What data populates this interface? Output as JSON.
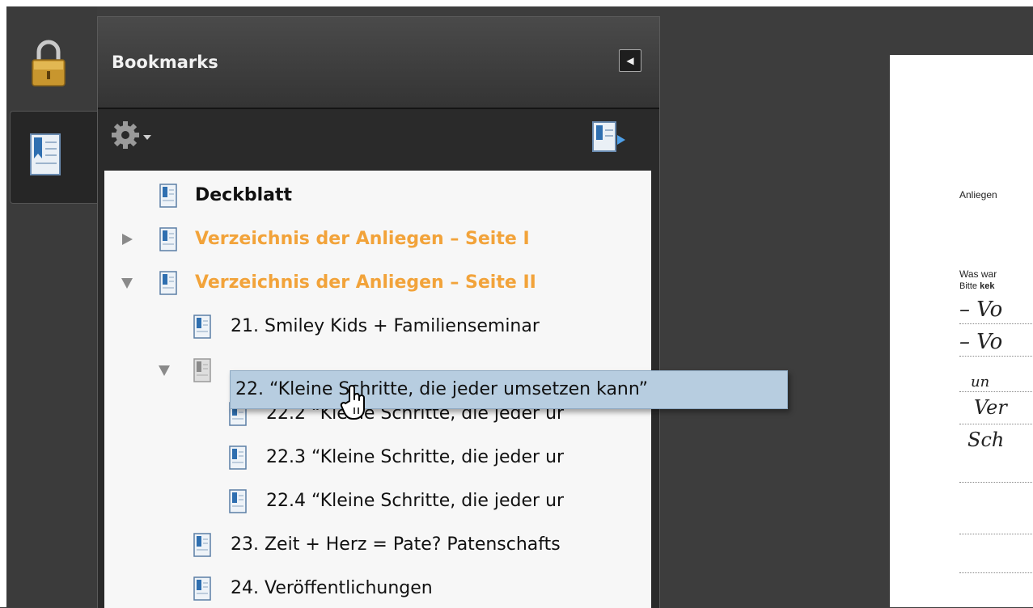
{
  "sidebar": {
    "lock_icon": "lock-icon",
    "bookmarks_tab_icon": "bookmarks-icon"
  },
  "panel": {
    "title": "Bookmarks",
    "collapse_icon": "triangle-left-icon",
    "options_icon": "gear-icon",
    "new_bookmark_icon": "new-bookmark-icon"
  },
  "bookmarks": [
    {
      "label": "Deckblatt",
      "style": "bold",
      "expander": "none"
    },
    {
      "label": "Verzeichnis der Anliegen – Seite I",
      "style": "orange",
      "expander": "collapsed"
    },
    {
      "label": "Verzeichnis der Anliegen – Seite II",
      "style": "orange",
      "expander": "expanded"
    },
    {
      "label": "21. Smiley Kids + Familienseminar",
      "style": "normal",
      "expander": "none"
    },
    {
      "label": "22. “Kleine Schritte, die jeder umsetzen kann”",
      "style": "normal",
      "expander": "expanded"
    },
    {
      "label": "22.2 “Kleine Schritte, die jeder ur",
      "style": "normal",
      "expander": "none"
    },
    {
      "label": "22.3 “Kleine Schritte, die jeder ur",
      "style": "normal",
      "expander": "none"
    },
    {
      "label": "22.4 “Kleine Schritte, die jeder ur",
      "style": "normal",
      "expander": "none"
    },
    {
      "label": "23. Zeit + Herz = Pate? Patenschafts",
      "style": "normal",
      "expander": "none"
    },
    {
      "label": "24. Veröffentlichungen",
      "style": "normal",
      "expander": "none"
    }
  ],
  "tooltip": {
    "text": "22. “Kleine Schritte, die jeder umsetzen kann”"
  },
  "document": {
    "line1": "Anliegen",
    "line2": "Was war",
    "line3_prefix": "Bitte ",
    "line3_bold": "kek",
    "handwriting_1": "– Vo",
    "handwriting_2": "– Vo",
    "handwriting_3": "un",
    "handwriting_4": "Ver",
    "handwriting_5": "Sch"
  },
  "colors": {
    "orange_bookmark": "#f2a33a",
    "tooltip_bg": "#b7cde0",
    "panel_bg": "#2a2a2a",
    "tree_bg": "#f7f7f7"
  }
}
